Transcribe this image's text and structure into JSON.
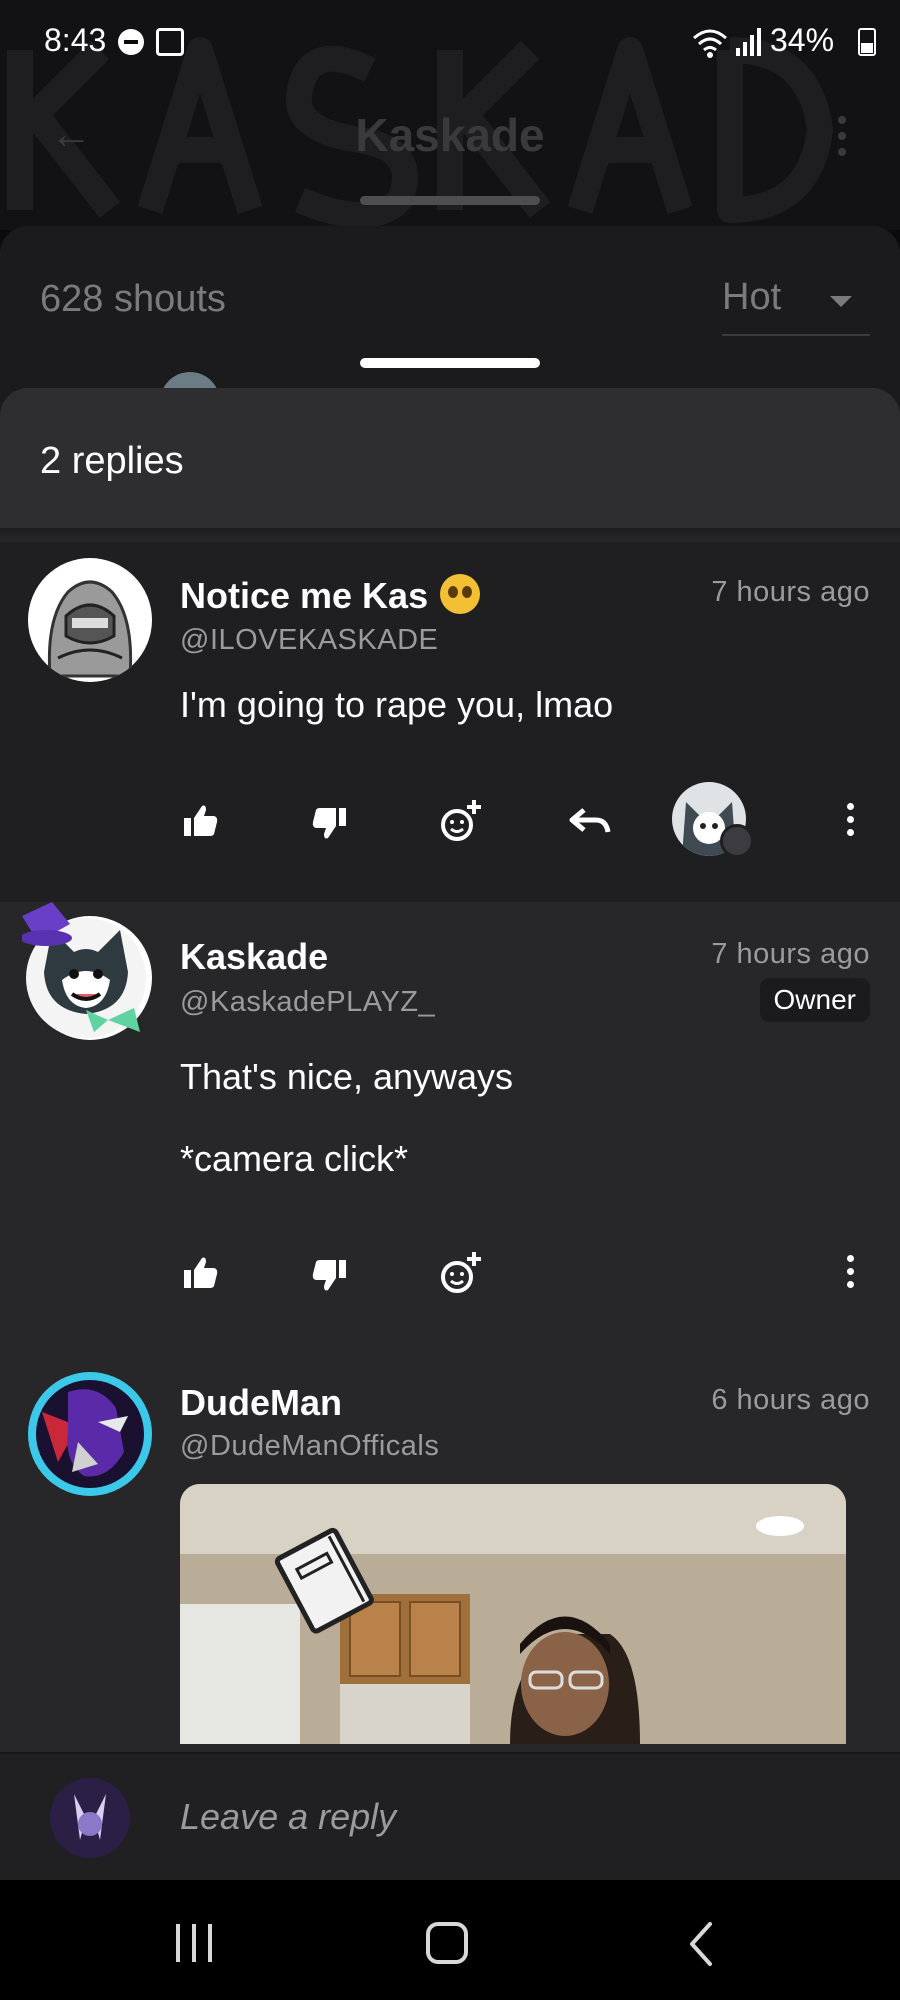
{
  "status_bar": {
    "time": "8:43",
    "battery": "34%"
  },
  "background_page": {
    "title": "Kaskade"
  },
  "shouts": {
    "count": "628 shouts",
    "sort": "Hot"
  },
  "replies_sheet": {
    "title": "2 replies",
    "comments": [
      {
        "name": "Notice me Kas",
        "handle": "@ILOVEKASKADE",
        "time": "7 hours ago",
        "body": [
          "I'm going to rape you, lmao"
        ],
        "badge": ""
      },
      {
        "name": "Kaskade",
        "handle": "@KaskadePLAYZ_",
        "time": "7 hours ago",
        "body": [
          "That's nice, anyways",
          "*camera click*"
        ],
        "badge": "Owner"
      },
      {
        "name": "DudeMan",
        "handle": "@DudeManOfficals",
        "time": "6 hours ago",
        "body": [],
        "badge": ""
      }
    ]
  },
  "composer": {
    "placeholder": "Leave a reply"
  },
  "colors": {
    "sheet": "#27272a",
    "parent_comment": "#1f1f21",
    "muted_text": "#9b9b9f",
    "accent": "#ffffff"
  }
}
